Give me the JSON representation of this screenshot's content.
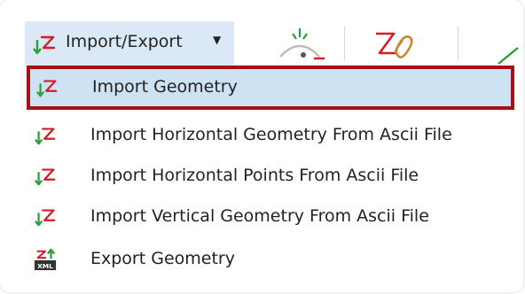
{
  "toolbar": {
    "dropdown_label": "Import/Export",
    "dropdown_caret": "▼",
    "dropdown_icon": "import-geometry-icon",
    "buttons": [
      {
        "icon": "compass-icon"
      },
      {
        "icon": "geometry-attach-icon"
      }
    ]
  },
  "menu": {
    "items": [
      {
        "label": "Import Geometry",
        "icon": "import-geometry-icon",
        "selected": true
      },
      {
        "label": "Import Horizontal Geometry From Ascii File",
        "icon": "import-geometry-icon",
        "selected": false
      },
      {
        "label": "Import Horizontal Points From Ascii File",
        "icon": "import-geometry-icon",
        "selected": false
      },
      {
        "label": "Import Vertical Geometry From Ascii File",
        "icon": "import-geometry-icon",
        "selected": false
      },
      {
        "label": "Export Geometry",
        "icon": "export-xml-icon",
        "selected": false
      }
    ]
  },
  "colors": {
    "selection_bg": "#cde3f4",
    "selection_border": "#a50f15",
    "dropdown_bg": "#dbe8f5",
    "icon_red": "#d7192a",
    "icon_green": "#2e9e3a"
  }
}
